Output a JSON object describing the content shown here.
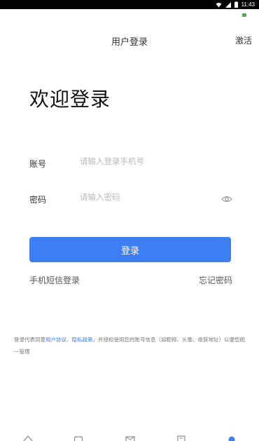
{
  "status_bar": {
    "time": "11:43",
    "icons": [
      "wifi-icon",
      "signal-icon",
      "battery-icon"
    ]
  },
  "header": {
    "title": "用户登录",
    "activate_label": "激活"
  },
  "welcome": "欢迎登录",
  "account": {
    "label": "账号",
    "placeholder": "请输入登录手机号"
  },
  "password": {
    "label": "密码",
    "placeholder": "请输入密码"
  },
  "login_button": "登录",
  "sms_login": "手机短信登录",
  "forgot_password": "忘记密码",
  "agreement": {
    "prefix": "登录代表同意",
    "user_agreement": "用户协议",
    "separator": "、",
    "privacy_policy": "隐私政策",
    "suffix": "，并授权使用您的账号信息（如昵称、头像、收获地址）以便您统一管理"
  },
  "colors": {
    "accent": "#3d7ff2",
    "status_bar": "#000000",
    "notification": "#4caf50"
  },
  "tab_icons": [
    "home-icon",
    "square-icon",
    "mail-icon",
    "document-icon",
    "profile-icon"
  ]
}
